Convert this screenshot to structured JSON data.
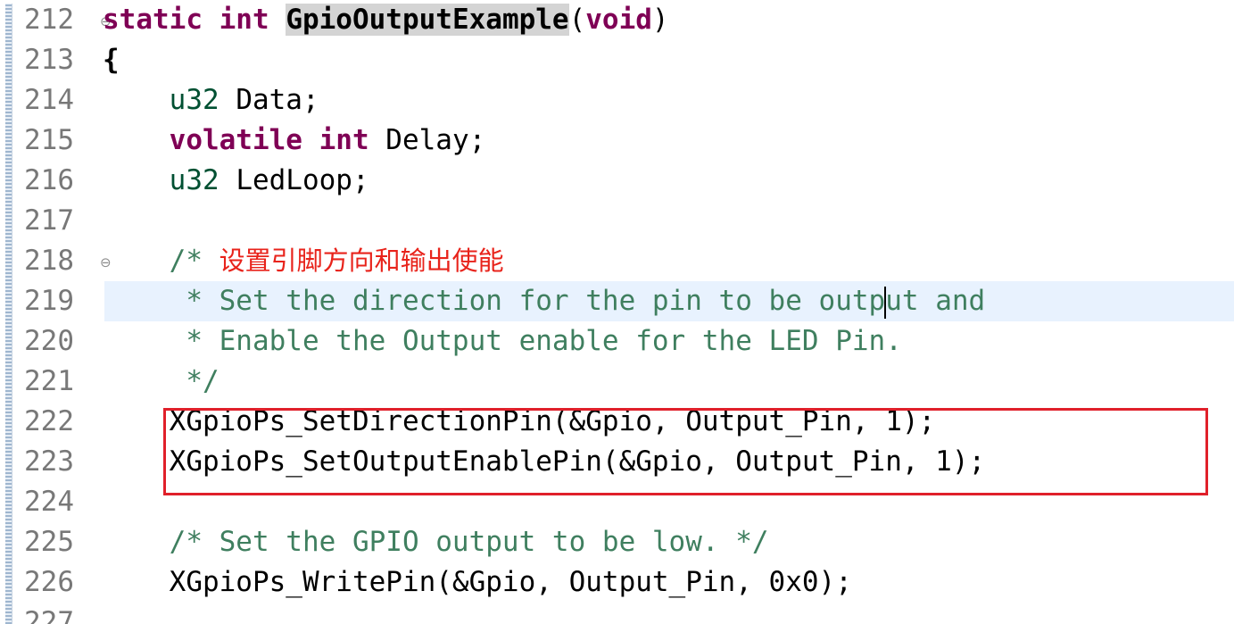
{
  "editor": {
    "lines": [
      {
        "num": "212",
        "fold": "⊖",
        "parts": [
          {
            "t": "static int ",
            "c": "kw"
          },
          {
            "t": "GpioOutputExample",
            "c": "fn-hl"
          },
          {
            "t": "(",
            "c": ""
          },
          {
            "t": "void",
            "c": "kw"
          },
          {
            "t": ")",
            "c": ""
          }
        ]
      },
      {
        "num": "213",
        "fold": "",
        "parts": [
          {
            "t": "{",
            "c": "bold"
          }
        ]
      },
      {
        "num": "214",
        "fold": "",
        "parts": [
          {
            "t": "    u32",
            "c": "type"
          },
          {
            "t": " Data;",
            "c": ""
          }
        ]
      },
      {
        "num": "215",
        "fold": "",
        "parts": [
          {
            "t": "    volatile int",
            "c": "kw"
          },
          {
            "t": " Delay;",
            "c": ""
          }
        ]
      },
      {
        "num": "216",
        "fold": "",
        "parts": [
          {
            "t": "    u32",
            "c": "type"
          },
          {
            "t": " LedLoop;",
            "c": ""
          }
        ]
      },
      {
        "num": "217",
        "fold": "",
        "parts": []
      },
      {
        "num": "218",
        "fold": "⊖",
        "parts": [
          {
            "t": "    /* ",
            "c": "cmt"
          },
          {
            "t": "设置引脚方向和输出使能",
            "c": "cmt-cn"
          }
        ]
      },
      {
        "num": "219",
        "fold": "",
        "current": true,
        "parts": [
          {
            "t": "     * Set the direction for the pin to be outp",
            "c": "cmt"
          },
          {
            "t": "",
            "c": "caret"
          },
          {
            "t": "ut and",
            "c": "cmt"
          }
        ]
      },
      {
        "num": "220",
        "fold": "",
        "parts": [
          {
            "t": "     * Enable the Output enable for the LED Pin.",
            "c": "cmt"
          }
        ]
      },
      {
        "num": "221",
        "fold": "",
        "parts": [
          {
            "t": "     */",
            "c": "cmt"
          }
        ]
      },
      {
        "num": "222",
        "fold": "",
        "parts": [
          {
            "t": "    XGpioPs_SetDirectionPin(&Gpio, Output_Pin, 1);",
            "c": ""
          }
        ]
      },
      {
        "num": "223",
        "fold": "",
        "parts": [
          {
            "t": "    XGpioPs_SetOutputEnablePin(&Gpio, Output_Pin, 1);",
            "c": ""
          }
        ]
      },
      {
        "num": "224",
        "fold": "",
        "parts": []
      },
      {
        "num": "225",
        "fold": "",
        "parts": [
          {
            "t": "    /* Set the GPIO output to be low. */",
            "c": "cmt"
          }
        ]
      },
      {
        "num": "226",
        "fold": "",
        "parts": [
          {
            "t": "    XGpioPs_WritePin(&Gpio, Output_Pin, 0x0);",
            "c": ""
          }
        ]
      },
      {
        "num": "227",
        "fold": "",
        "parts": []
      }
    ]
  },
  "colors": {
    "keyword": "#7f0055",
    "type": "#005032",
    "comment": "#3f7f5f",
    "annotation_red": "#e8231b",
    "current_line": "#e8f2fe",
    "highlight_box": "#e0202a"
  }
}
